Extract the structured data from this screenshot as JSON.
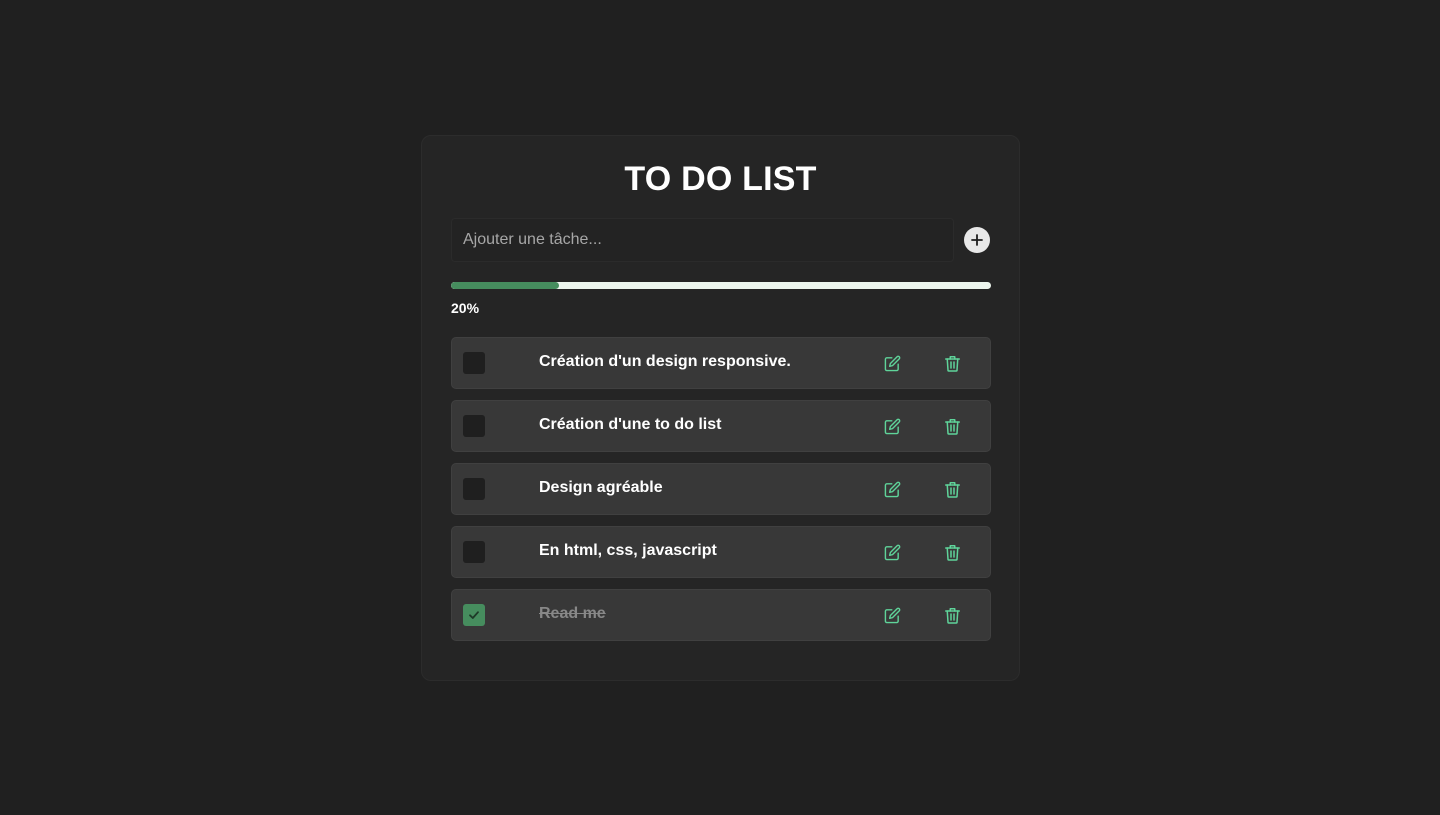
{
  "app": {
    "title": "TO DO LIST"
  },
  "input": {
    "placeholder": "Ajouter une tâche...",
    "value": ""
  },
  "add_button": {
    "icon": "plus-icon"
  },
  "progress": {
    "percent": 20,
    "label": "20%",
    "fill_color": "#468d5e",
    "track_color": "#edf6ee"
  },
  "tasks": [
    {
      "text": "Création d'un design responsive.",
      "done": false
    },
    {
      "text": "Création d'une to do list",
      "done": false
    },
    {
      "text": "Design agréable",
      "done": false
    },
    {
      "text": "En html, css, javascript",
      "done": false
    },
    {
      "text": "Read me",
      "done": true
    }
  ],
  "icons": {
    "edit": "pencil-square-icon",
    "delete": "trash-icon",
    "check": "check-icon"
  },
  "colors": {
    "accent": "#468d5e",
    "icon_green": "#5fd49a",
    "background": "#202020",
    "card": "#252525",
    "task_bg": "#383838"
  }
}
